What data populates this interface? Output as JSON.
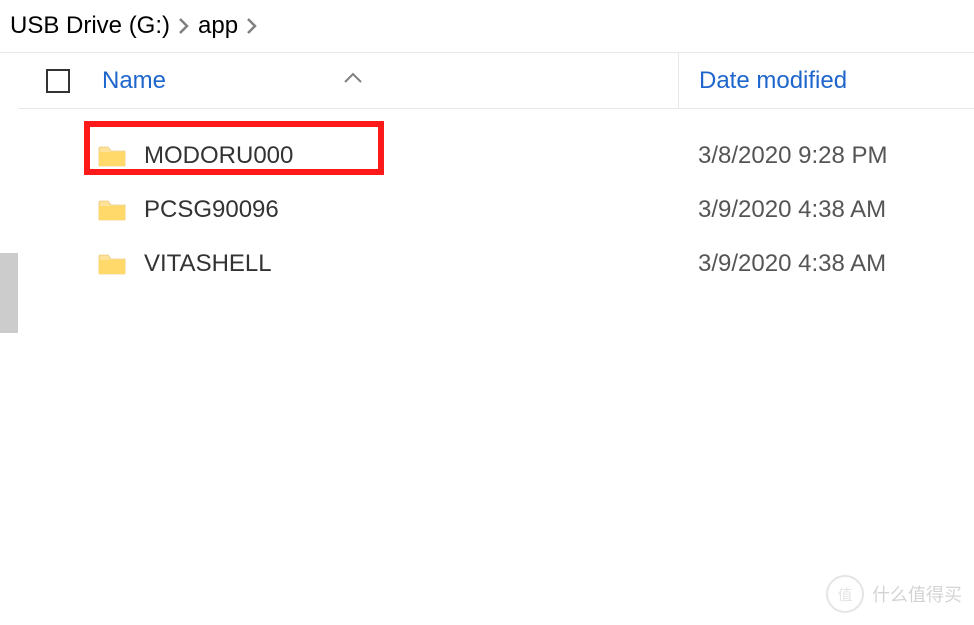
{
  "breadcrumb": {
    "items": [
      "USB Drive (G:)",
      "app"
    ]
  },
  "headers": {
    "name": "Name",
    "date": "Date modified"
  },
  "rows": [
    {
      "name": "MODORU000",
      "date": "3/8/2020 9:28 PM",
      "highlighted": true
    },
    {
      "name": "PCSG90096",
      "date": "3/9/2020 4:38 AM",
      "highlighted": false
    },
    {
      "name": "VITASHELL",
      "date": "3/9/2020 4:38 AM",
      "highlighted": false
    }
  ],
  "watermark": {
    "badge": "值",
    "text": "什么值得买"
  }
}
